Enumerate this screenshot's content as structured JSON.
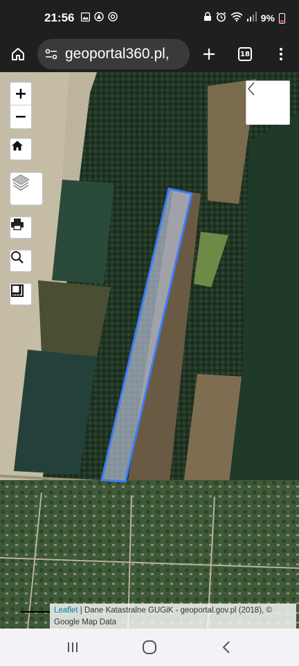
{
  "status_bar": {
    "time": "21:56",
    "battery": "9%",
    "left_icons": [
      "image-icon",
      "alert-icon",
      "radar-icon"
    ],
    "right_icons": [
      "lock-icon",
      "alarm-icon",
      "wifi-icon",
      "signal-icon",
      "battery-icon"
    ]
  },
  "browser": {
    "url": "geoportal360.pl,",
    "tab_count": "18"
  },
  "map": {
    "zoom_in_label": "+",
    "zoom_out_label": "−",
    "controls": [
      "home-icon",
      "layers-icon",
      "print-icon",
      "search-icon",
      "measure-icon"
    ],
    "side_panel_toggle": "chevron-left-icon",
    "attribution": {
      "leaflet_link": "Leaflet",
      "rest": " | Dane Katastralne GUGiK - geoportal.gov.pl (2018), © Google Map Data"
    },
    "parcel_highlight_color": "#3d7cf5"
  },
  "navbar": {
    "items": [
      "recent-apps-icon",
      "home-circle-icon",
      "back-icon"
    ]
  }
}
